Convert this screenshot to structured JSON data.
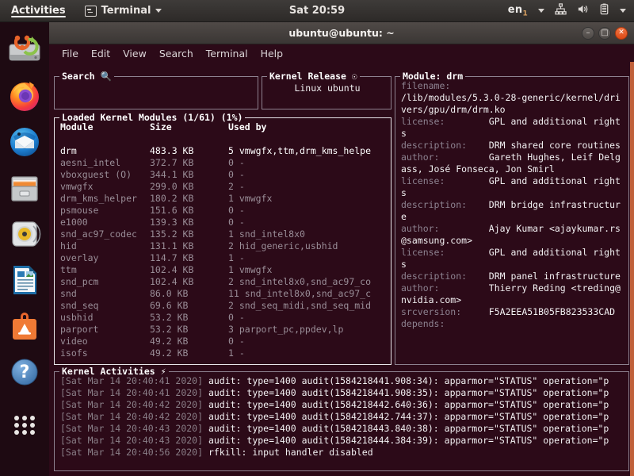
{
  "topbar": {
    "activities": "Activities",
    "app_menu": "Terminal",
    "app_icon": "terminal-icon",
    "clock": "Sat 20:59",
    "language": "en",
    "language_sub": "1",
    "tray_icons": [
      "network-icon",
      "volume-icon",
      "battery-icon",
      "chevron-down-icon"
    ]
  },
  "dock": {
    "items": [
      {
        "name": "install-ubuntu-icon",
        "label": "Install Ubuntu"
      },
      {
        "name": "firefox-icon",
        "label": "Firefox"
      },
      {
        "name": "thunderbird-icon",
        "label": "Thunderbird Mail"
      },
      {
        "name": "files-icon",
        "label": "Files"
      },
      {
        "name": "rhythmbox-icon",
        "label": "Rhythmbox"
      },
      {
        "name": "libreoffice-writer-icon",
        "label": "LibreOffice Writer"
      },
      {
        "name": "ubuntu-software-icon",
        "label": "Ubuntu Software"
      },
      {
        "name": "help-icon",
        "label": "Help"
      },
      {
        "name": "show-applications-icon",
        "label": "Show Applications"
      }
    ]
  },
  "window": {
    "title": "ubuntu@ubuntu: ~",
    "minimize": "–",
    "maximize": "□",
    "close": "✕",
    "menu": [
      "File",
      "Edit",
      "View",
      "Search",
      "Terminal",
      "Help"
    ]
  },
  "tui": {
    "search": {
      "legend": "Search 🔍",
      "value": "",
      "placeholder": ""
    },
    "kernel_release": {
      "legend": "Kernel Release ☉",
      "value": "Linux ubuntu"
    },
    "modules": {
      "legend": "Loaded Kernel Modules (1/61) (1%)",
      "columns": [
        "Module",
        "Size",
        "Used by"
      ],
      "rows": [
        {
          "module": "drm",
          "size": "483.3 KB",
          "used_by": "5 vmwgfx,ttm,drm_kms_helpe",
          "selected": true
        },
        {
          "module": "aesni_intel",
          "size": "372.7 KB",
          "used_by": "0 -",
          "selected": false
        },
        {
          "module": "vboxguest (O)",
          "size": "344.1 KB",
          "used_by": "0 -",
          "selected": false
        },
        {
          "module": "vmwgfx",
          "size": "299.0 KB",
          "used_by": "2 -",
          "selected": false
        },
        {
          "module": "drm_kms_helper",
          "size": "180.2 KB",
          "used_by": "1 vmwgfx",
          "selected": false
        },
        {
          "module": "psmouse",
          "size": "151.6 KB",
          "used_by": "0 -",
          "selected": false
        },
        {
          "module": "e1000",
          "size": "139.3 KB",
          "used_by": "0 -",
          "selected": false
        },
        {
          "module": "snd_ac97_codec",
          "size": "135.2 KB",
          "used_by": "1 snd_intel8x0",
          "selected": false
        },
        {
          "module": "hid",
          "size": "131.1 KB",
          "used_by": "2 hid_generic,usbhid",
          "selected": false
        },
        {
          "module": "overlay",
          "size": "114.7 KB",
          "used_by": "1 -",
          "selected": false
        },
        {
          "module": "ttm",
          "size": "102.4 KB",
          "used_by": "1 vmwgfx",
          "selected": false
        },
        {
          "module": "snd_pcm",
          "size": "102.4 KB",
          "used_by": "2 snd_intel8x0,snd_ac97_co",
          "selected": false
        },
        {
          "module": "snd",
          "size": "86.0 KB",
          "used_by": "11 snd_intel8x0,snd_ac97_c",
          "selected": false
        },
        {
          "module": "snd_seq",
          "size": "69.6 KB",
          "used_by": "2 snd_seq_midi,snd_seq_mid",
          "selected": false
        },
        {
          "module": "usbhid",
          "size": "53.2 KB",
          "used_by": "0 -",
          "selected": false
        },
        {
          "module": "parport",
          "size": "53.2 KB",
          "used_by": "3 parport_pc,ppdev,lp",
          "selected": false
        },
        {
          "module": "video",
          "size": "49.2 KB",
          "used_by": "0 -",
          "selected": false
        },
        {
          "module": "isofs",
          "size": "49.2 KB",
          "used_by": "1 -",
          "selected": false
        }
      ]
    },
    "module_detail": {
      "legend": "Module: drm",
      "fields": [
        {
          "key": "filename:",
          "value": "/lib/modules/5.3.0-28-generic/kernel/drivers/gpu/drm/drm.ko",
          "inline": false
        },
        {
          "key": "license:",
          "value": "GPL and additional rights",
          "inline": true
        },
        {
          "key": "description:",
          "value": "DRM shared core routines",
          "inline": true
        },
        {
          "key": "author:",
          "value": "Gareth Hughes, Leif Delgass, José Fonseca, Jon Smirl",
          "inline": true
        },
        {
          "key": "license:",
          "value": "GPL and additional rights",
          "inline": true
        },
        {
          "key": "description:",
          "value": "DRM bridge infrastructure",
          "inline": true
        },
        {
          "key": "author:",
          "value": "Ajay Kumar <ajaykumar.rs@samsung.com>",
          "inline": true
        },
        {
          "key": "license:",
          "value": "GPL and additional rights",
          "inline": true
        },
        {
          "key": "description:",
          "value": "DRM panel infrastructure",
          "inline": true
        },
        {
          "key": "author:",
          "value": "Thierry Reding <treding@nvidia.com>",
          "inline": true
        },
        {
          "key": "srcversion:",
          "value": "F5A2EEA51B05FB823533CAD",
          "inline": true
        },
        {
          "key": "depends:",
          "value": "",
          "inline": true
        }
      ]
    },
    "activities": {
      "legend": "Kernel Activities ⚡",
      "lines": [
        {
          "timestamp": "[Sat Mar 14 20:40:41 2020]",
          "message": "audit: type=1400 audit(1584218441.908:34): apparmor=\"STATUS\" operation=\"p"
        },
        {
          "timestamp": "[Sat Mar 14 20:40:41 2020]",
          "message": "audit: type=1400 audit(1584218441.908:35): apparmor=\"STATUS\" operation=\"p"
        },
        {
          "timestamp": "[Sat Mar 14 20:40:42 2020]",
          "message": "audit: type=1400 audit(1584218442.640:36): apparmor=\"STATUS\" operation=\"p"
        },
        {
          "timestamp": "[Sat Mar 14 20:40:42 2020]",
          "message": "audit: type=1400 audit(1584218442.744:37): apparmor=\"STATUS\" operation=\"p"
        },
        {
          "timestamp": "[Sat Mar 14 20:40:43 2020]",
          "message": "audit: type=1400 audit(1584218443.840:38): apparmor=\"STATUS\" operation=\"p"
        },
        {
          "timestamp": "[Sat Mar 14 20:40:43 2020]",
          "message": "audit: type=1400 audit(1584218444.384:39): apparmor=\"STATUS\" operation=\"p"
        },
        {
          "timestamp": "[Sat Mar 14 20:40:56 2020]",
          "message": "rfkill: input handler disabled"
        }
      ]
    }
  },
  "colors": {
    "terminal_bg": "#2c0a18",
    "accent_orange": "#dd4814",
    "topbar_bg": "#3e3b39",
    "dim_text": "#9a8e98",
    "bright_text": "#f3f1f3",
    "scrollbar": "#c0603a"
  }
}
